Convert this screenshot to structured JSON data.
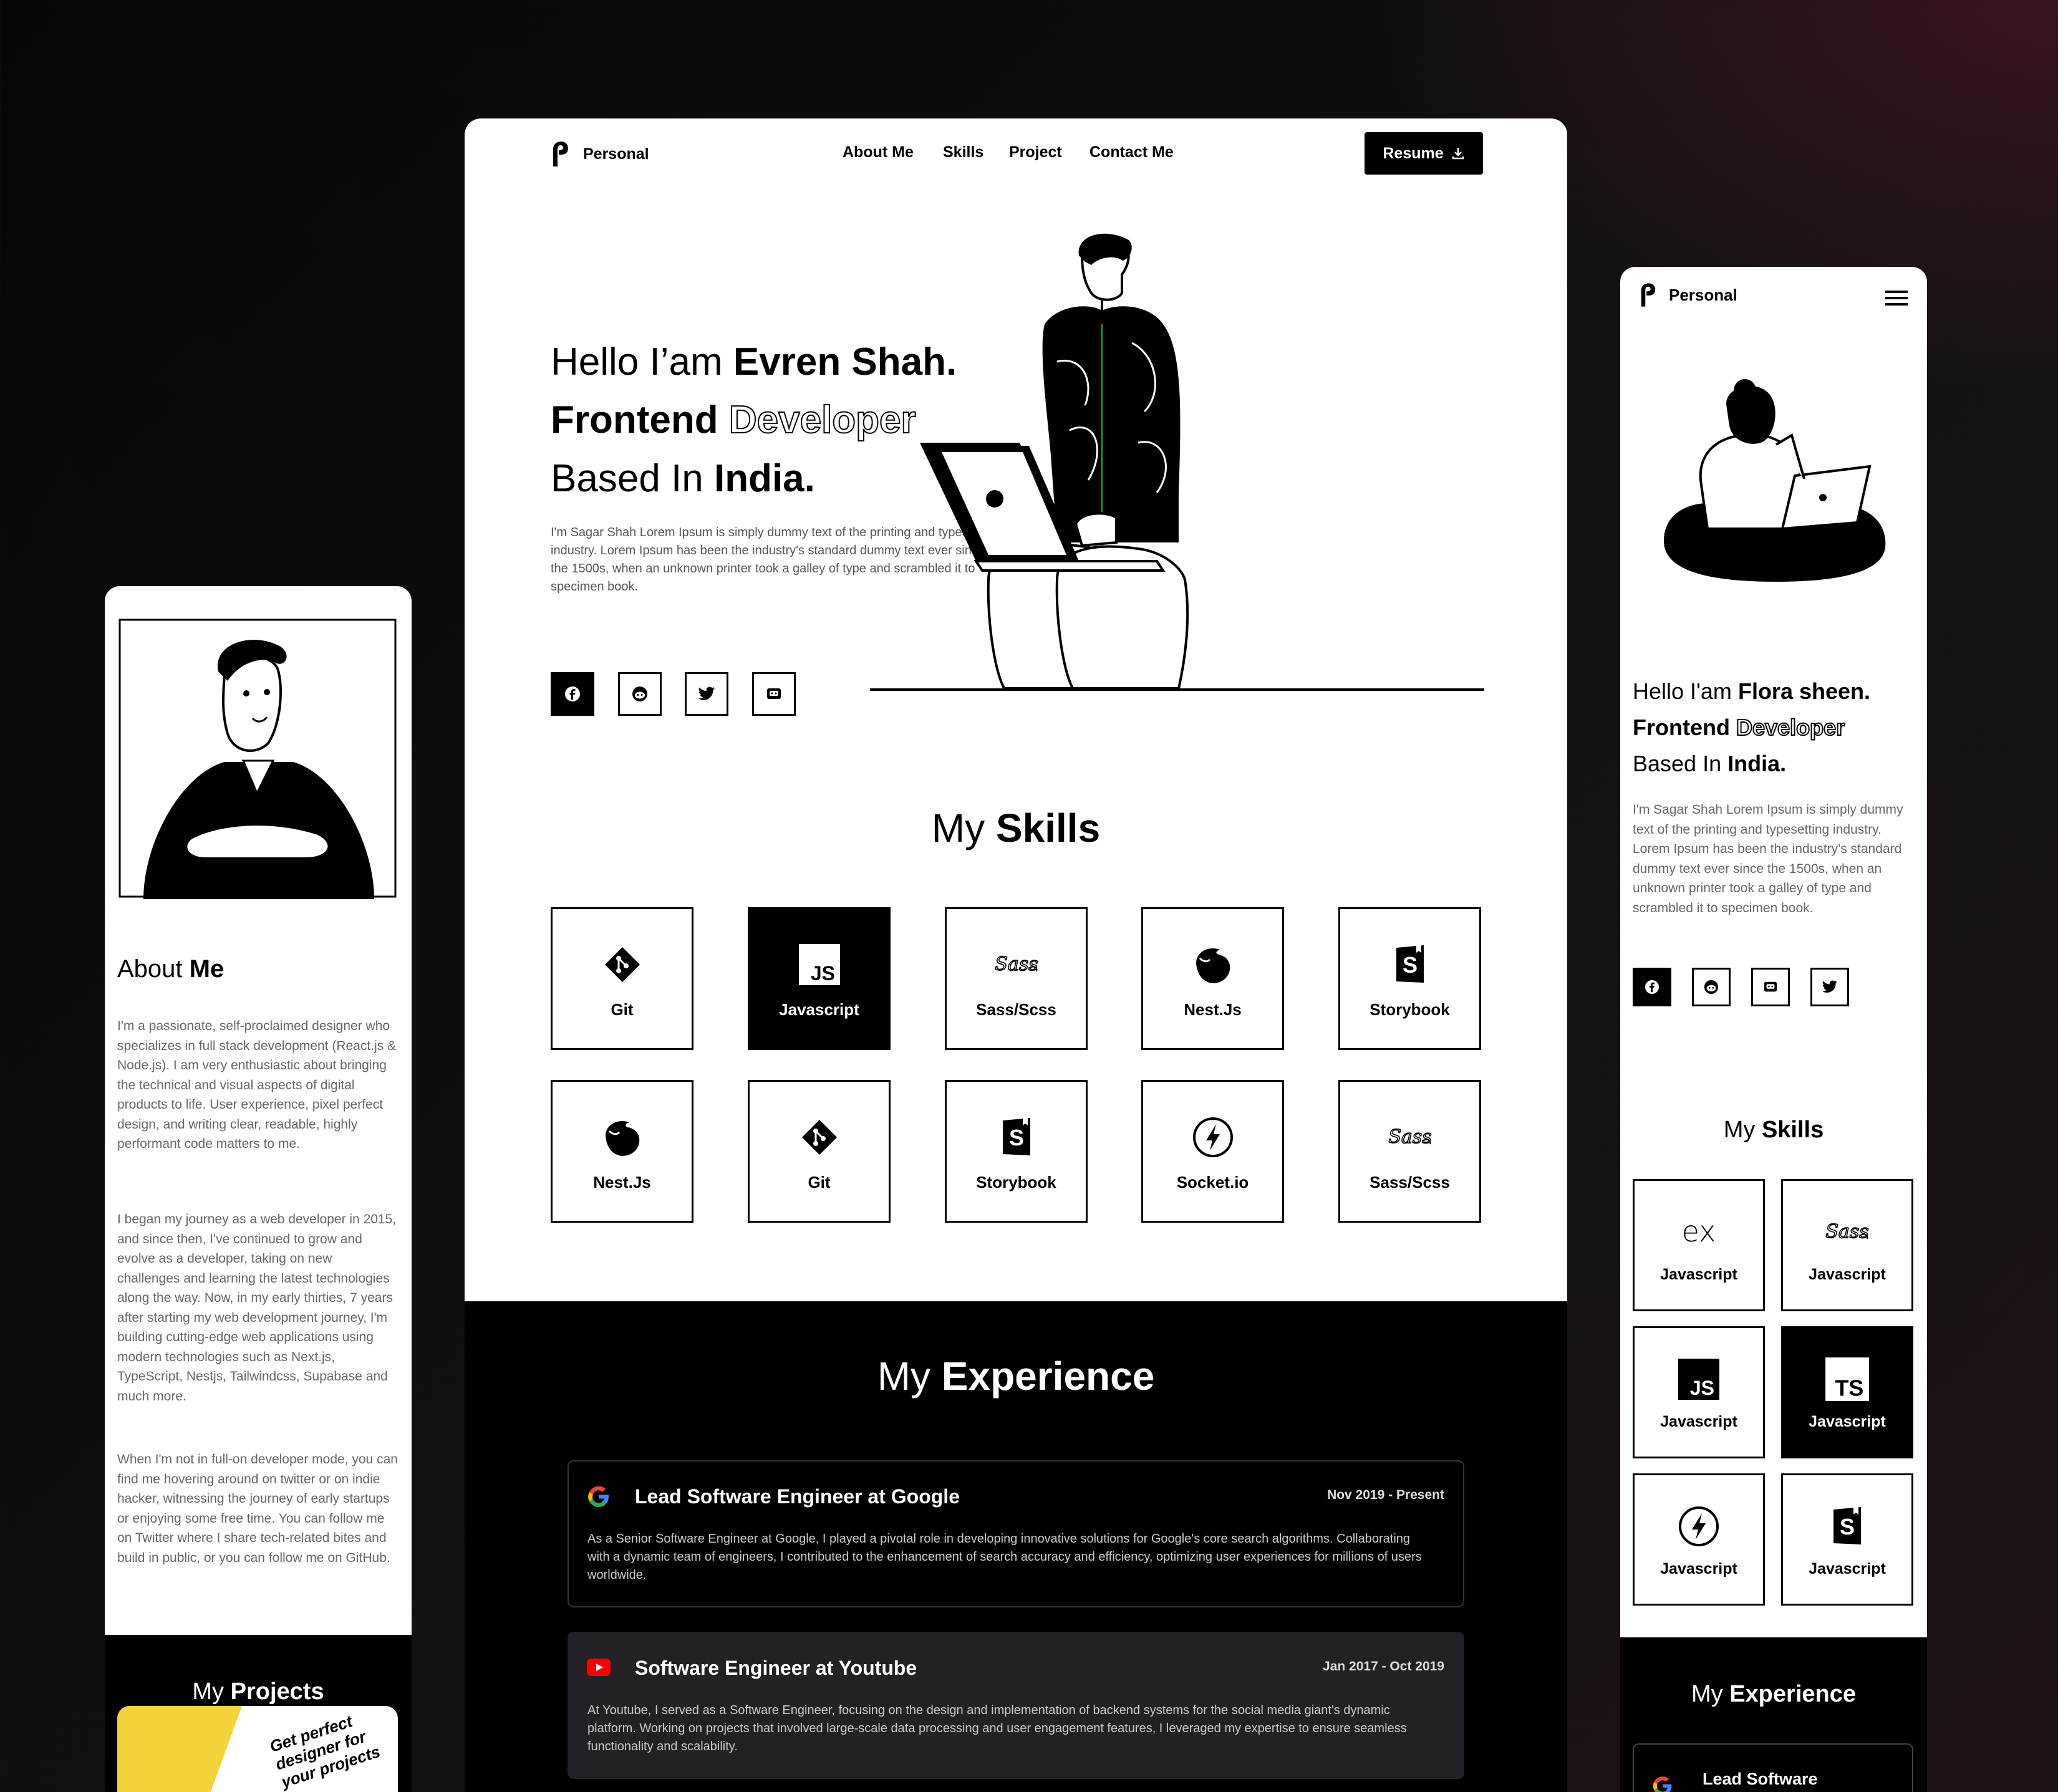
{
  "desktop": {
    "brand": "Personal",
    "nav": [
      "About Me",
      "Skills",
      "Project",
      "Contact Me"
    ],
    "resume_label": "Resume",
    "hero": {
      "line1_a": "Hello I’am",
      "line1_b": "Evren Shah.",
      "line2_a": "Frontend",
      "line2_b": "Developer",
      "line3_a": "Based In",
      "line3_b": "India.",
      "desc": "I'm Sagar Shah Lorem Ipsum is simply dummy text of the printing and typesetting industry. Lorem Ipsum has been the industry's standard dummy text ever since the 1500s, when an unknown printer took a galley of type and scrambled it to specimen book."
    },
    "social_icons": [
      "facebook-icon",
      "reddit-icon",
      "twitter-icon",
      "discord-icon"
    ],
    "skills_title_a": "My",
    "skills_title_b": "Skills",
    "skills": [
      {
        "label": "Git",
        "icon": "git-icon",
        "active": false
      },
      {
        "label": "Javascript",
        "icon": "javascript-icon",
        "active": true
      },
      {
        "label": "Sass/Scss",
        "icon": "sass-icon",
        "active": false
      },
      {
        "label": "Nest.Js",
        "icon": "nestjs-icon",
        "active": false
      },
      {
        "label": "Storybook",
        "icon": "storybook-icon",
        "active": false
      },
      {
        "label": "Nest.Js",
        "icon": "nestjs-icon",
        "active": false
      },
      {
        "label": "Git",
        "icon": "git-icon",
        "active": false
      },
      {
        "label": "Storybook",
        "icon": "storybook-icon",
        "active": false
      },
      {
        "label": "Socket.io",
        "icon": "socketio-icon",
        "active": false
      },
      {
        "label": "Sass/Scss",
        "icon": "sass-icon",
        "active": false
      }
    ],
    "experience_title_a": "My",
    "experience_title_b": "Experience",
    "experience": [
      {
        "title": "Lead Software Engineer at Google",
        "date": "Nov 2019 - Present",
        "icon": "google-icon",
        "desc": "As a Senior Software Engineer at Google, I played a pivotal role in developing innovative solutions for Google's core search algorithms. Collaborating with a dynamic team of engineers, I contributed to the enhancement of search accuracy and efficiency, optimizing user experiences for millions of users worldwide."
      },
      {
        "title": "Software Engineer at Youtube",
        "date": "Jan 2017 - Oct 2019",
        "icon": "youtube-icon",
        "desc": "At Youtube, I served as a  Software Engineer, focusing on the design and implementation of backend systems for the social media giant's dynamic platform. Working on projects that involved large-scale data processing and user engagement features, I leveraged my expertise to ensure seamless functionality and scalability."
      }
    ]
  },
  "about_mobile": {
    "title_a": "About",
    "title_b": "Me",
    "p1": "I'm a passionate, self-proclaimed designer who specializes in full stack development (React.js & Node.js). I am very enthusiastic about bringing the technical and visual aspects of digital products to life. User experience, pixel perfect design, and writing clear, readable, highly performant code matters to me.",
    "p2": "I began my journey as a web developer in 2015, and since then, I've continued to grow and evolve as a developer, taking on new challenges and learning the latest technologies along the way. Now, in my early thirties, 7 years after starting my web development journey, I'm building cutting-edge web applications using modern technologies such as Next.js, TypeScript, Nestjs, Tailwindcss, Supabase and much more.",
    "p3": "When I'm not in full-on developer mode, you can find me hovering around on twitter or on indie hacker, witnessing the journey of early startups or enjoying some free time. You can follow me on Twitter where I share tech-related bites and build in public, or you can follow me on GitHub.",
    "projects_a": "My",
    "projects_b": "Projects",
    "project_card_text": "Get perfect designer for your projects"
  },
  "mobile": {
    "brand": "Personal",
    "line1_a": "Hello I'am",
    "line1_b": "Flora sheen.",
    "line2_a": "Frontend",
    "line2_b": "Developer",
    "line3_a": "Based In",
    "line3_b": "India.",
    "desc": "I'm Sagar Shah Lorem Ipsum is simply dummy text of the printing and typesetting industry. Lorem Ipsum has been the industry's standard dummy text ever since the 1500s, when an unknown printer took a galley of type and scrambled it to specimen book.",
    "social_icons": [
      "facebook-icon",
      "reddit-icon",
      "discord-icon",
      "twitter-icon"
    ],
    "skills_title_a": "My",
    "skills_title_b": "Skills",
    "skills": [
      {
        "label": "Javascript",
        "icon": "express-icon",
        "active": false
      },
      {
        "label": "Javascript",
        "icon": "sass-icon",
        "active": false
      },
      {
        "label": "Javascript",
        "icon": "javascript-icon",
        "active": false
      },
      {
        "label": "Javascript",
        "icon": "typescript-icon",
        "active": true
      },
      {
        "label": "Javascript",
        "icon": "socketio-icon",
        "active": false
      },
      {
        "label": "Javascript",
        "icon": "storybook-icon",
        "active": false
      }
    ],
    "experience_title_a": "My",
    "experience_title_b": "Experience",
    "exp_peek": "Lead Software"
  }
}
